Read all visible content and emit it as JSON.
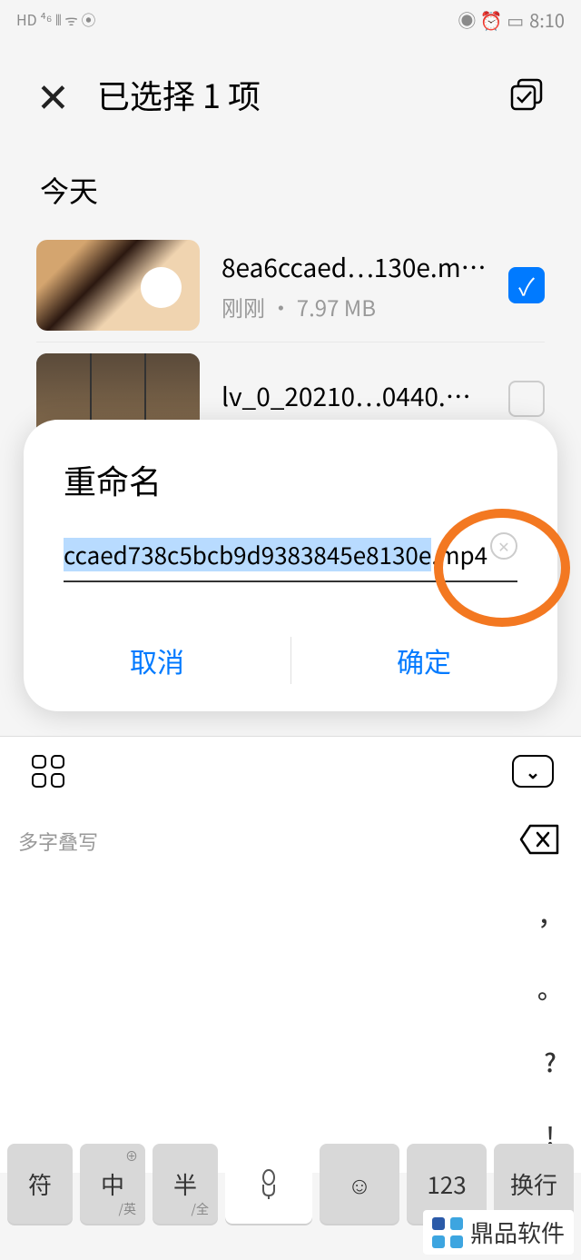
{
  "status": {
    "indicators_left": "HD ⁴⁶ ⫴ ᯤ ⦿",
    "indicators_right": "◉ ⏰ ▭",
    "time": "8:10"
  },
  "header": {
    "title": "已选择 1 项"
  },
  "section": {
    "today": "今天"
  },
  "files": [
    {
      "name": "8ea6ccaed…130e.mp4",
      "meta": "刚刚 · 7.97 MB",
      "checked": true
    },
    {
      "name": "lv_0_20210…0440.mp4",
      "meta": "",
      "checked": false
    }
  ],
  "dialog": {
    "title": "重命名",
    "input_value": "ccaed738c5bcb9d9383845e8130e",
    "input_ext": ".mp4",
    "cancel": "取消",
    "confirm": "确定"
  },
  "keyboard": {
    "suggestion": "多字叠写",
    "symbols": [
      "，",
      "。",
      "?",
      "!"
    ],
    "keys": {
      "symbol": "符",
      "zh": "中",
      "zh_sub": "/英",
      "half": "半",
      "half_sub": "/全",
      "globe": "⊕"
    }
  },
  "watermark": "鼎品软件"
}
